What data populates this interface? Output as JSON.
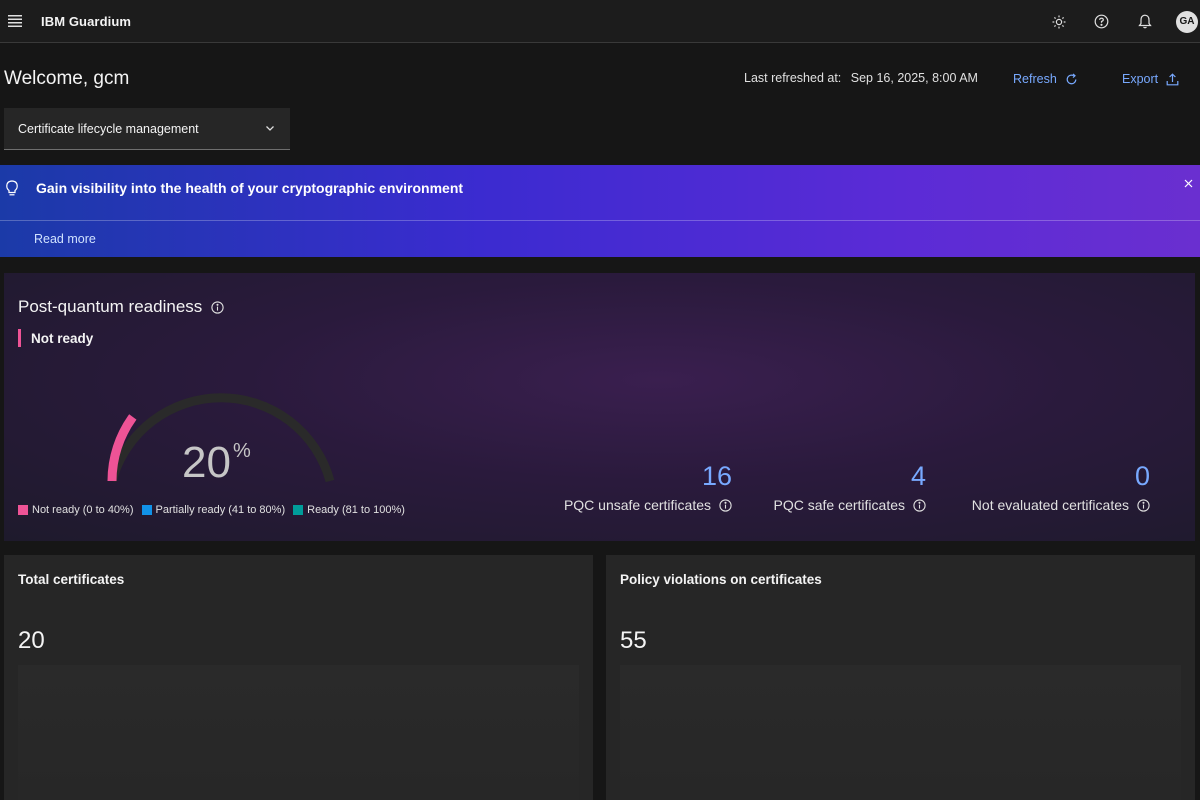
{
  "header": {
    "brand": "IBM Guardium",
    "avatar_initials": "GA",
    "icons": [
      "menu-icon",
      "sun-icon",
      "help-icon",
      "notification-icon"
    ]
  },
  "welcome": {
    "greeting": "Welcome, gcm",
    "last_refreshed_label": "Last refreshed at:",
    "last_refreshed_value": "Sep 16, 2025, 8:00 AM",
    "refresh_label": "Refresh",
    "export_label": "Export"
  },
  "dropdown": {
    "selected": "Certificate lifecycle management"
  },
  "banner": {
    "title": "Gain visibility into the health of your cryptographic environment",
    "link": "Read more",
    "colors": [
      "#1b3aa8",
      "#6a2fd0"
    ]
  },
  "readiness": {
    "title": "Post-quantum readiness",
    "status": "Not ready",
    "percent": "20",
    "percent_unit": "%",
    "gauge_fraction": 0.2,
    "legend": [
      {
        "label": "Not ready (0 to 40%)",
        "color": "#ee5396"
      },
      {
        "label": "Partially ready (41 to 80%)",
        "color": "#1192e8"
      },
      {
        "label": "Ready (81 to 100%)",
        "color": "#009d9a"
      }
    ],
    "metrics": [
      {
        "value": "16",
        "label": "PQC unsafe certificates"
      },
      {
        "value": "4",
        "label": "PQC safe certificates"
      },
      {
        "value": "0",
        "label": "Not evaluated certificates"
      }
    ]
  },
  "tiles": [
    {
      "title": "Total certificates",
      "value": "20"
    },
    {
      "title": "Policy violations on certificates",
      "value": "55"
    }
  ]
}
